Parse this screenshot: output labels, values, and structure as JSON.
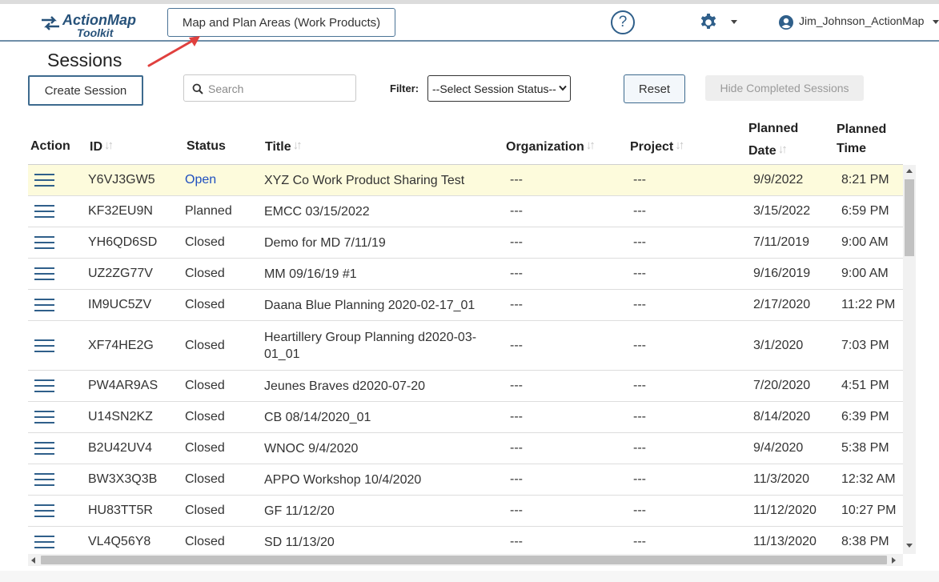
{
  "header": {
    "logo_line1": "ActionMap",
    "logo_line2": "Toolkit",
    "map_button_label": "Map and Plan Areas (Work Products)",
    "help_label": "?",
    "username": "Jim_Johnson_ActionMap"
  },
  "colors": {
    "brand": "#27527a",
    "accent": "#3d6a8e",
    "highlight_row": "#fdfbdc",
    "open_status": "#1f4fbf"
  },
  "page": {
    "title": "Sessions",
    "create_button": "Create Session",
    "search_placeholder": "Search",
    "filter_label": "Filter:",
    "filter_selected": "--Select Session Status--",
    "reset_button": "Reset",
    "hide_completed_button": "Hide Completed Sessions"
  },
  "table": {
    "columns": {
      "action": "Action",
      "id": "ID",
      "status": "Status",
      "title": "Title",
      "organization": "Organization",
      "project": "Project",
      "planned_date_1": "Planned",
      "planned_date_2": "Date",
      "planned_time_1": "Planned",
      "planned_time_2": "Time"
    },
    "rows": [
      {
        "id": "Y6VJ3GW5",
        "status": "Open",
        "title": "XYZ Co Work Product Sharing Test",
        "organization": "---",
        "project": "---",
        "date": "9/9/2022",
        "time": "8:21 PM"
      },
      {
        "id": "KF32EU9N",
        "status": "Planned",
        "title": "EMCC 03/15/2022",
        "organization": "---",
        "project": "---",
        "date": "3/15/2022",
        "time": "6:59 PM"
      },
      {
        "id": "YH6QD6SD",
        "status": "Closed",
        "title": "Demo for MD 7/11/19",
        "organization": "---",
        "project": "---",
        "date": "7/11/2019",
        "time": "9:00 AM"
      },
      {
        "id": "UZ2ZG77V",
        "status": "Closed",
        "title": "MM 09/16/19 #1",
        "organization": "---",
        "project": "---",
        "date": "9/16/2019",
        "time": "9:00 AM"
      },
      {
        "id": "IM9UC5ZV",
        "status": "Closed",
        "title": "Daana Blue Planning 2020-02-17_01",
        "organization": "---",
        "project": "---",
        "date": "2/17/2020",
        "time": "11:22 PM"
      },
      {
        "id": "XF74HE2G",
        "status": "Closed",
        "title": "Heartillery Group Planning d2020-03-01_01",
        "organization": "---",
        "project": "---",
        "date": "3/1/2020",
        "time": "7:03 PM"
      },
      {
        "id": "PW4AR9AS",
        "status": "Closed",
        "title": "Jeunes Braves d2020-07-20",
        "organization": "---",
        "project": "---",
        "date": "7/20/2020",
        "time": "4:51 PM"
      },
      {
        "id": "U14SN2KZ",
        "status": "Closed",
        "title": "CB 08/14/2020_01",
        "organization": "---",
        "project": "---",
        "date": "8/14/2020",
        "time": "6:39 PM"
      },
      {
        "id": "B2U42UV4",
        "status": "Closed",
        "title": "WNOC 9/4/2020",
        "organization": "---",
        "project": "---",
        "date": "9/4/2020",
        "time": "5:38 PM"
      },
      {
        "id": "BW3X3Q3B",
        "status": "Closed",
        "title": "APPO Workshop 10/4/2020",
        "organization": "---",
        "project": "---",
        "date": "11/3/2020",
        "time": "12:32 AM"
      },
      {
        "id": "HU83TT5R",
        "status": "Closed",
        "title": "GF 11/12/20",
        "organization": "---",
        "project": "---",
        "date": "11/12/2020",
        "time": "10:27 PM"
      },
      {
        "id": "VL4Q56Y8",
        "status": "Closed",
        "title": "SD 11/13/20",
        "organization": "---",
        "project": "---",
        "date": "11/13/2020",
        "time": "8:38 PM"
      }
    ]
  }
}
